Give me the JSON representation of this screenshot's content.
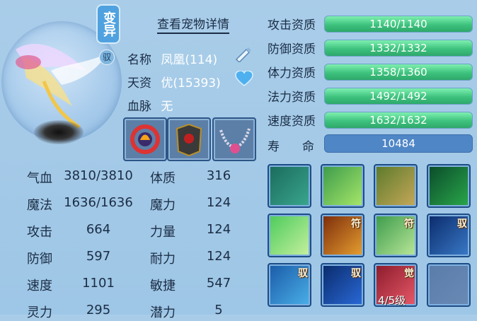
{
  "pet": {
    "badge_variant": "变异",
    "badge_yu": "驭",
    "detail_link": "查看宠物详情",
    "name_label": "名称",
    "name_value": "凤凰(114)",
    "talent_label": "天资",
    "talent_value": "优(15393)",
    "bloodline_label": "血脉",
    "bloodline_value": "无"
  },
  "stats": [
    {
      "label": "气血",
      "value": "3810/3810",
      "label2": "体质",
      "value2": "316"
    },
    {
      "label": "魔法",
      "value": "1636/1636",
      "label2": "魔力",
      "value2": "124"
    },
    {
      "label": "攻击",
      "value": "664",
      "label2": "力量",
      "value2": "124"
    },
    {
      "label": "防御",
      "value": "597",
      "label2": "耐力",
      "value2": "124"
    },
    {
      "label": "速度",
      "value": "1101",
      "label2": "敏捷",
      "value2": "547"
    },
    {
      "label": "灵力",
      "value": "295",
      "label2": "潜力",
      "value2": "5"
    }
  ],
  "aptitudes": [
    {
      "label": "攻击资质",
      "text": "1140/1140",
      "fill": 1.0
    },
    {
      "label": "防御资质",
      "text": "1332/1332",
      "fill": 1.0
    },
    {
      "label": "体力资质",
      "text": "1358/1360",
      "fill": 0.998
    },
    {
      "label": "法力资质",
      "text": "1492/1492",
      "fill": 1.0
    },
    {
      "label": "速度资质",
      "text": "1632/1632",
      "fill": 1.0
    }
  ],
  "life": {
    "label_a": "寿",
    "label_b": "命",
    "value": "10484"
  },
  "skills": [
    {
      "name": "skill-1",
      "tag": ""
    },
    {
      "name": "skill-2",
      "tag": ""
    },
    {
      "name": "skill-3",
      "tag": ""
    },
    {
      "name": "skill-4",
      "tag": ""
    },
    {
      "name": "skill-5",
      "tag": ""
    },
    {
      "name": "skill-6",
      "tag": "符"
    },
    {
      "name": "skill-7",
      "tag": "符"
    },
    {
      "name": "skill-8",
      "tag": "驭"
    },
    {
      "name": "skill-9",
      "tag": "驭"
    },
    {
      "name": "skill-10",
      "tag": "驭"
    },
    {
      "name": "skill-11",
      "tag": "觉"
    },
    {
      "name": "skill-12",
      "tag": ""
    }
  ],
  "skill_level": "4/5级",
  "colors": {
    "bar_fill": "#3ec27e",
    "bar_bg": "#55a8d8",
    "panel": "#a9cde9"
  }
}
